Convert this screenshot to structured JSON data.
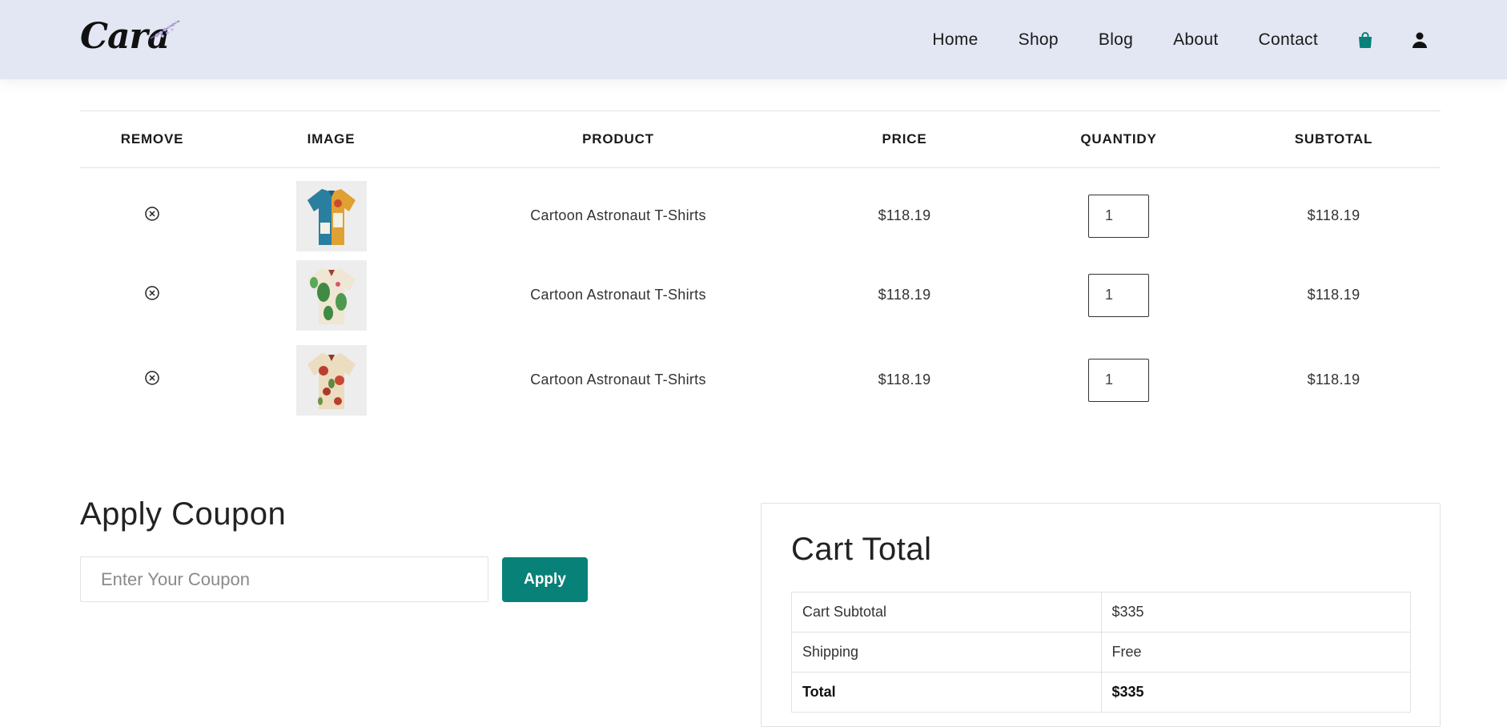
{
  "header": {
    "logo_text": "Cara",
    "nav": [
      {
        "label": "Home"
      },
      {
        "label": "Shop"
      },
      {
        "label": "Blog"
      },
      {
        "label": "About"
      },
      {
        "label": "Contact"
      }
    ],
    "icons": {
      "bag": "shopping-bag-icon",
      "user": "user-icon"
    },
    "accent_color": "#088178",
    "header_bg": "#e3e6f3"
  },
  "cart": {
    "columns": [
      "REMOVE",
      "IMAGE",
      "PRODUCT",
      "PRICE",
      "QUANTIDY",
      "SUBTOTAL"
    ],
    "rows": [
      {
        "product": "Cartoon Astronaut T-Shirts",
        "price": "$118.19",
        "quantity": "1",
        "subtotal": "$118.19",
        "image": "shirt-image-1"
      },
      {
        "product": "Cartoon Astronaut T-Shirts",
        "price": "$118.19",
        "quantity": "1",
        "subtotal": "$118.19",
        "image": "shirt-image-2"
      },
      {
        "product": "Cartoon Astronaut T-Shirts",
        "price": "$118.19",
        "quantity": "1",
        "subtotal": "$118.19",
        "image": "shirt-image-3"
      }
    ]
  },
  "coupon": {
    "title": "Apply Coupon",
    "placeholder": "Enter Your Coupon",
    "button_label": "Apply"
  },
  "totals": {
    "title": "Cart Total",
    "rows": [
      {
        "label": "Cart Subtotal",
        "value": "$335"
      },
      {
        "label": "Shipping",
        "value": "Free"
      },
      {
        "label": "Total",
        "value": "$335"
      }
    ]
  }
}
